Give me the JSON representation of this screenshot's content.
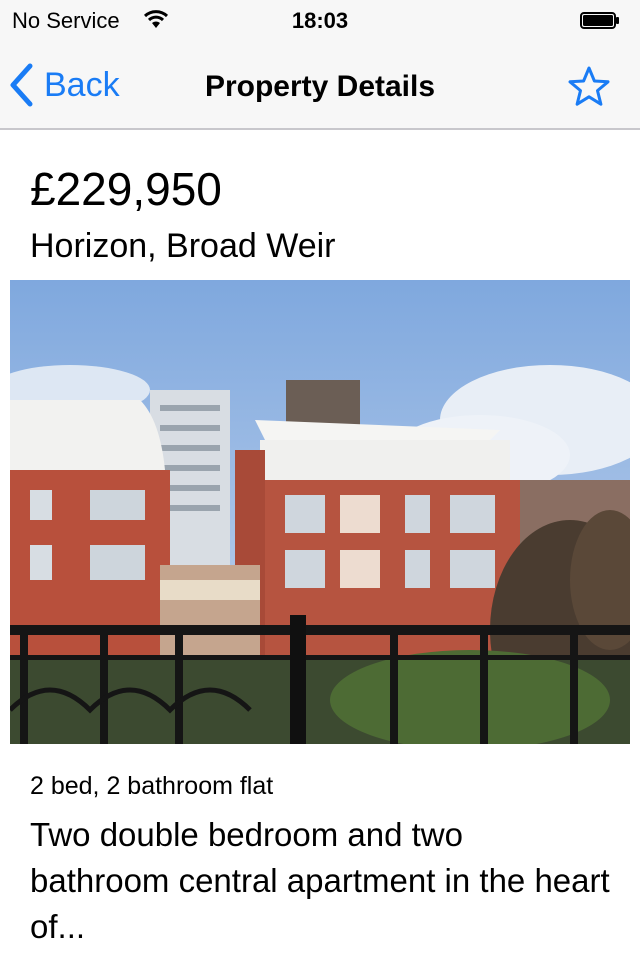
{
  "status": {
    "carrier": "No Service",
    "time": "18:03"
  },
  "nav": {
    "back_label": "Back",
    "title": "Property Details"
  },
  "property": {
    "price": "£229,950",
    "address": "Horizon, Broad Weir",
    "summary": "2 bed, 2 bathroom flat",
    "description": "Two double bedroom and two bathroom central apartment in the heart of..."
  },
  "colors": {
    "accent": "#1a7cf5",
    "bar_bg": "#f7f7f7",
    "divider": "#c8c7cc"
  },
  "icons": {
    "back": "chevron-left-icon",
    "favorite": "star-outline-icon",
    "wifi": "wifi-icon",
    "battery": "battery-icon"
  }
}
